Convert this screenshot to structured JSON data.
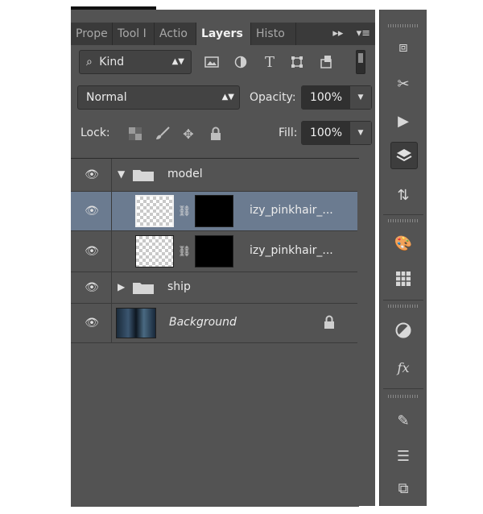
{
  "tabs": [
    "Prope",
    "Tool I",
    "Actio",
    "Layers",
    "Histo"
  ],
  "filter": {
    "label": "Kind"
  },
  "blend": {
    "mode": "Normal",
    "opacity_label": "Opacity:",
    "opacity_value": "100%"
  },
  "lock": {
    "label": "Lock:",
    "fill_label": "Fill:",
    "fill_value": "100%"
  },
  "layers": [
    {
      "name": "model",
      "type": "group",
      "expanded": true
    },
    {
      "name": "izy_pinkhair_...",
      "type": "layer",
      "selected": true
    },
    {
      "name": "izy_pinkhair_...",
      "type": "layer",
      "selected": false
    },
    {
      "name": "ship",
      "type": "group",
      "expanded": false
    },
    {
      "name": "Background",
      "type": "background",
      "locked": true
    }
  ],
  "icons": {
    "filters": [
      "image-filter-icon",
      "adjustment-filter-icon",
      "type-filter-icon",
      "shape-filter-icon",
      "smart-object-filter-icon"
    ],
    "locks": [
      "lock-transparent-icon",
      "lock-brush-icon",
      "lock-move-icon",
      "lock-all-icon"
    ],
    "strip": [
      "3d-icon",
      "tools-icon",
      "play-icon",
      "layers-icon",
      "layer-comps-icon",
      "swatches-icon",
      "grid-icon",
      "adjustments-icon",
      "styles-icon",
      "brush-icon",
      "brush-presets-icon",
      "clone-source-icon"
    ]
  },
  "colors": {
    "panel": "#535353",
    "selected_row": "#6b7b90",
    "tab_bar": "#3a3a3a"
  }
}
